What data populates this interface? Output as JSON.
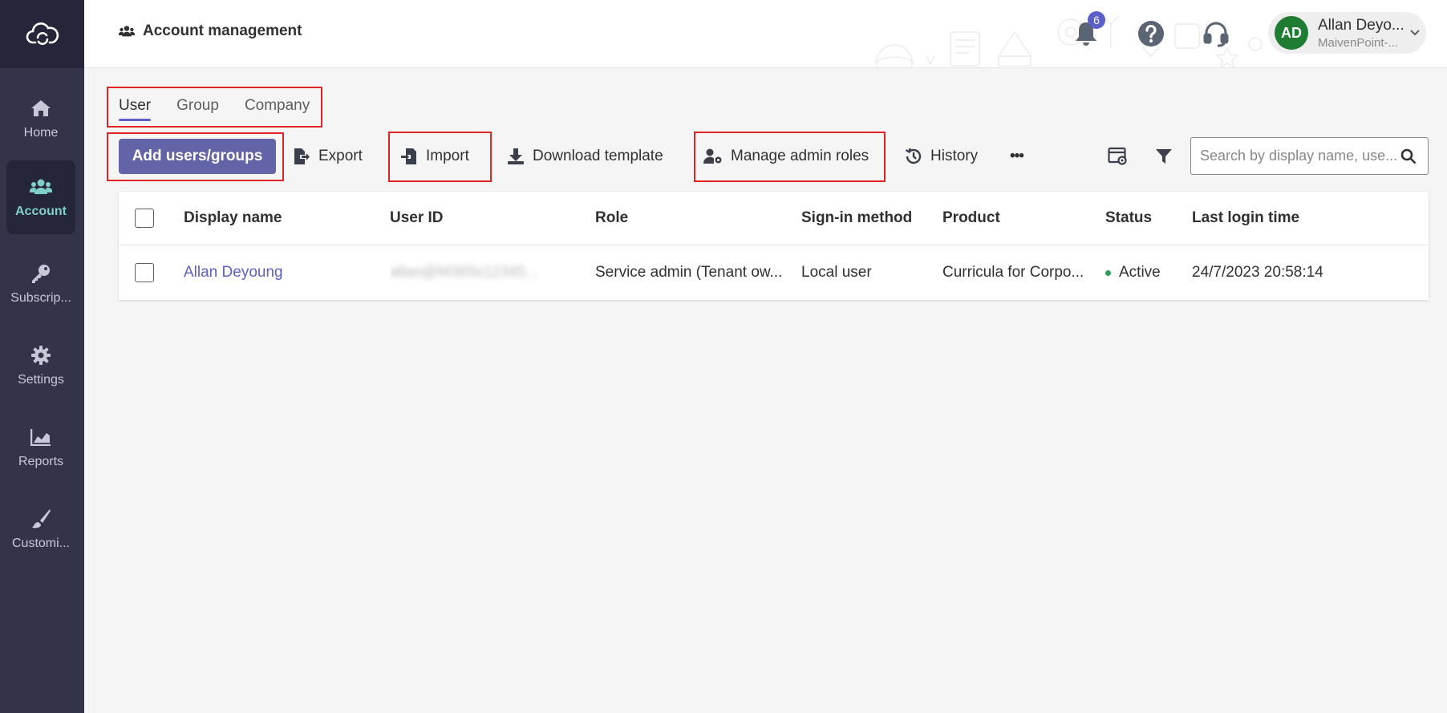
{
  "sidebar": {
    "items": [
      {
        "label": "Home",
        "icon": "home-icon"
      },
      {
        "label": "Account",
        "icon": "users-icon",
        "active": true
      },
      {
        "label": "Subscrip...",
        "icon": "key-icon"
      },
      {
        "label": "Settings",
        "icon": "gear-icon"
      },
      {
        "label": "Reports",
        "icon": "chart-icon"
      },
      {
        "label": "Customi...",
        "icon": "brush-icon"
      }
    ]
  },
  "header": {
    "title": "Account management",
    "notification_count": "6",
    "user": {
      "initials": "AD",
      "name": "Allan Deyo...",
      "org": "MaivenPoint-..."
    }
  },
  "tabs": [
    {
      "label": "User",
      "active": true
    },
    {
      "label": "Group"
    },
    {
      "label": "Company"
    }
  ],
  "toolbar": {
    "add_label": "Add users/groups",
    "export_label": "Export",
    "import_label": "Import",
    "download_label": "Download template",
    "manage_label": "Manage admin roles",
    "history_label": "History",
    "more_label": "•••",
    "search_placeholder": "Search by display name, use..."
  },
  "table": {
    "columns": [
      "Display name",
      "User ID",
      "Role",
      "Sign-in method",
      "Product",
      "Status",
      "Last login time"
    ],
    "rows": [
      {
        "display_name": "Allan Deyoung",
        "user_id": "allan@M365x12345...",
        "role": "Service admin (Tenant ow...",
        "signin": "Local user",
        "product": "Curricula for Corpo...",
        "status": "Active",
        "last_login": "24/7/2023 20:58:14"
      }
    ]
  },
  "colors": {
    "sidebar": "#33344a",
    "accent": "#6264a7",
    "active_nav": "#7fcfc8",
    "highlight_box": "#e02424",
    "status_active": "#2e9c5c"
  }
}
